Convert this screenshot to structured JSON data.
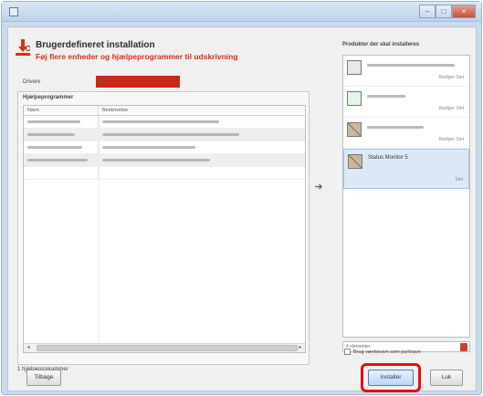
{
  "window": {
    "title": "",
    "controls": {
      "minimize": "–",
      "maximize": "□",
      "close": "×"
    }
  },
  "header": {
    "title": "Brugerdefineret installation",
    "subtitle": "Føj flere enheder og hjælpeprogrammer til udskrivning"
  },
  "driver": {
    "label": "Drivere",
    "value": ""
  },
  "utilities": {
    "section_label": "Hjælpeprogrammer",
    "columns": {
      "name": "Navn",
      "description": "Beskrivelse"
    },
    "rows": [
      {
        "name": "",
        "description": ""
      },
      {
        "name": "",
        "description": ""
      },
      {
        "name": "",
        "description": ""
      },
      {
        "name": "",
        "description": ""
      },
      {
        "name": "",
        "description": ""
      }
    ],
    "count_label": "1 hjælpeprogrammer"
  },
  "products": {
    "title": "Produkter der skal installeres",
    "items": [
      {
        "name": "",
        "meta": "Rediger  Slet",
        "icon": "printer-icon"
      },
      {
        "name": "",
        "meta": "Rediger  Slet",
        "icon": "document-icon"
      },
      {
        "name": "",
        "meta": "Rediger  Slet",
        "icon": "utility-icon"
      },
      {
        "name": "Status Monitor 5",
        "meta": "Slet",
        "icon": "utility-icon"
      }
    ],
    "footer_count": "4 elementer",
    "checkbox_label": "Brug værtsnavn som portnavn"
  },
  "buttons": {
    "back": "Tilbage",
    "install": "Installer",
    "close": "Luk"
  },
  "colors": {
    "accent_red": "#c7291b",
    "highlight_red": "#e01010",
    "title_red": "#d9301a"
  }
}
